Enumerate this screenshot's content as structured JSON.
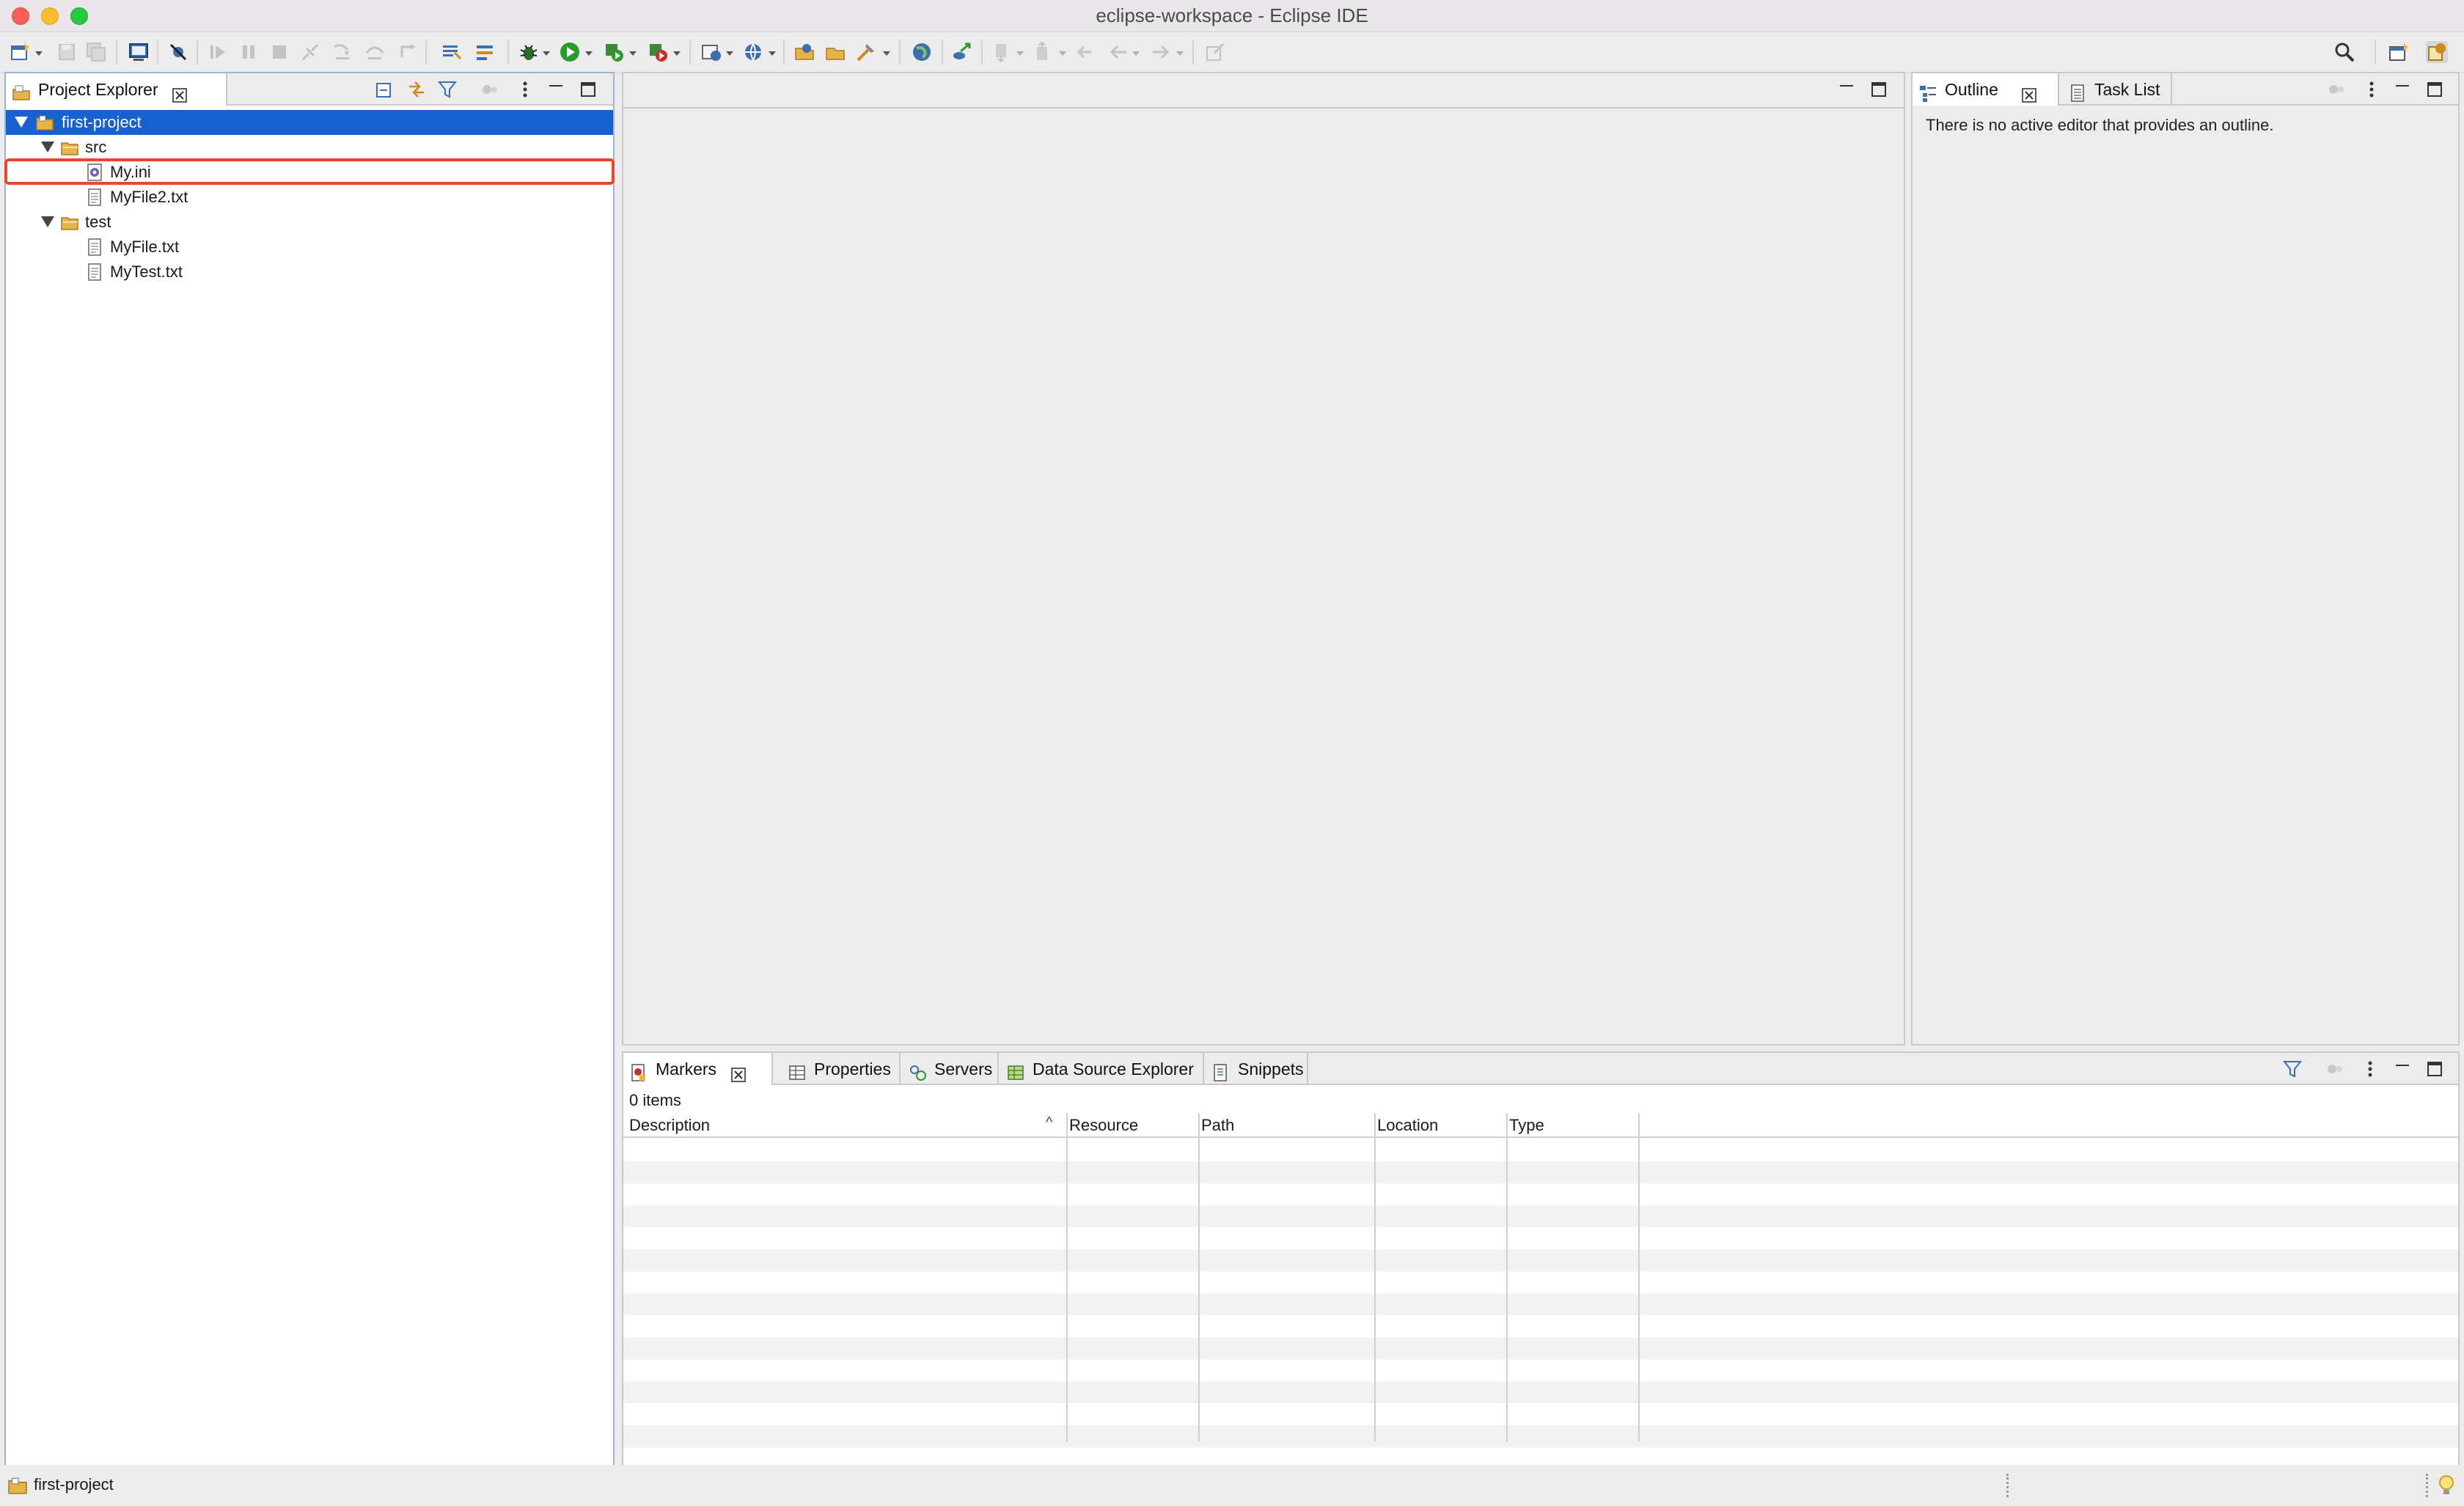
{
  "window": {
    "title": "eclipse-workspace - Eclipse IDE",
    "traffic_colors": [
      "#fc5f57",
      "#fdbc2e",
      "#28c840"
    ]
  },
  "toolbar": {
    "icons": [
      "new-wizard-icon",
      "save-icon",
      "save-all-icon",
      "console-icon",
      "skip-breakpoints-icon",
      "resume-icon",
      "suspend-icon",
      "terminate-icon",
      "disconnect-icon",
      "step-into-icon",
      "step-over-icon",
      "step-return-icon",
      "drop-to-frame-icon",
      "use-step-filters-icon",
      "debug-icon",
      "run-icon",
      "coverage-icon",
      "external-tools-icon",
      "new-server-icon",
      "new-web-service-icon",
      "open-type-icon",
      "open-task-icon",
      "search-tool-icon",
      "web-browser-icon",
      "new-connection-icon",
      "next-annotation-icon",
      "previous-annotation-icon",
      "last-edit-icon",
      "back-icon",
      "forward-icon",
      "pin-editor-icon",
      "search-icon",
      "open-perspective-icon",
      "java-ee-perspective-icon"
    ]
  },
  "project_explorer": {
    "tab_label": "Project Explorer",
    "tree": [
      {
        "label": "first-project",
        "level": 0,
        "kind": "project",
        "expanded": true,
        "selected": true
      },
      {
        "label": "src",
        "level": 1,
        "kind": "folder",
        "expanded": true
      },
      {
        "label": "My.ini",
        "level": 2,
        "kind": "ini-file",
        "highlighted": true
      },
      {
        "label": "MyFile2.txt",
        "level": 2,
        "kind": "text-file"
      },
      {
        "label": "test",
        "level": 1,
        "kind": "folder",
        "expanded": true
      },
      {
        "label": "MyFile.txt",
        "level": 2,
        "kind": "text-file"
      },
      {
        "label": "MyTest.txt",
        "level": 2,
        "kind": "text-file"
      }
    ]
  },
  "outline": {
    "tabs": [
      "Outline",
      "Task List"
    ],
    "message": "There is no active editor that provides an outline."
  },
  "bottom_panel": {
    "tabs": [
      "Markers",
      "Properties",
      "Servers",
      "Data Source Explorer",
      "Snippets"
    ],
    "count_text": "0 items",
    "columns": [
      "Description",
      "Resource",
      "Path",
      "Location",
      "Type"
    ],
    "sort_indicator": "^"
  },
  "statusbar": {
    "text": "first-project"
  },
  "colors": {
    "selection": "#1660d0",
    "highlight_box": "#e8472b",
    "folder": "#e7b44a"
  }
}
